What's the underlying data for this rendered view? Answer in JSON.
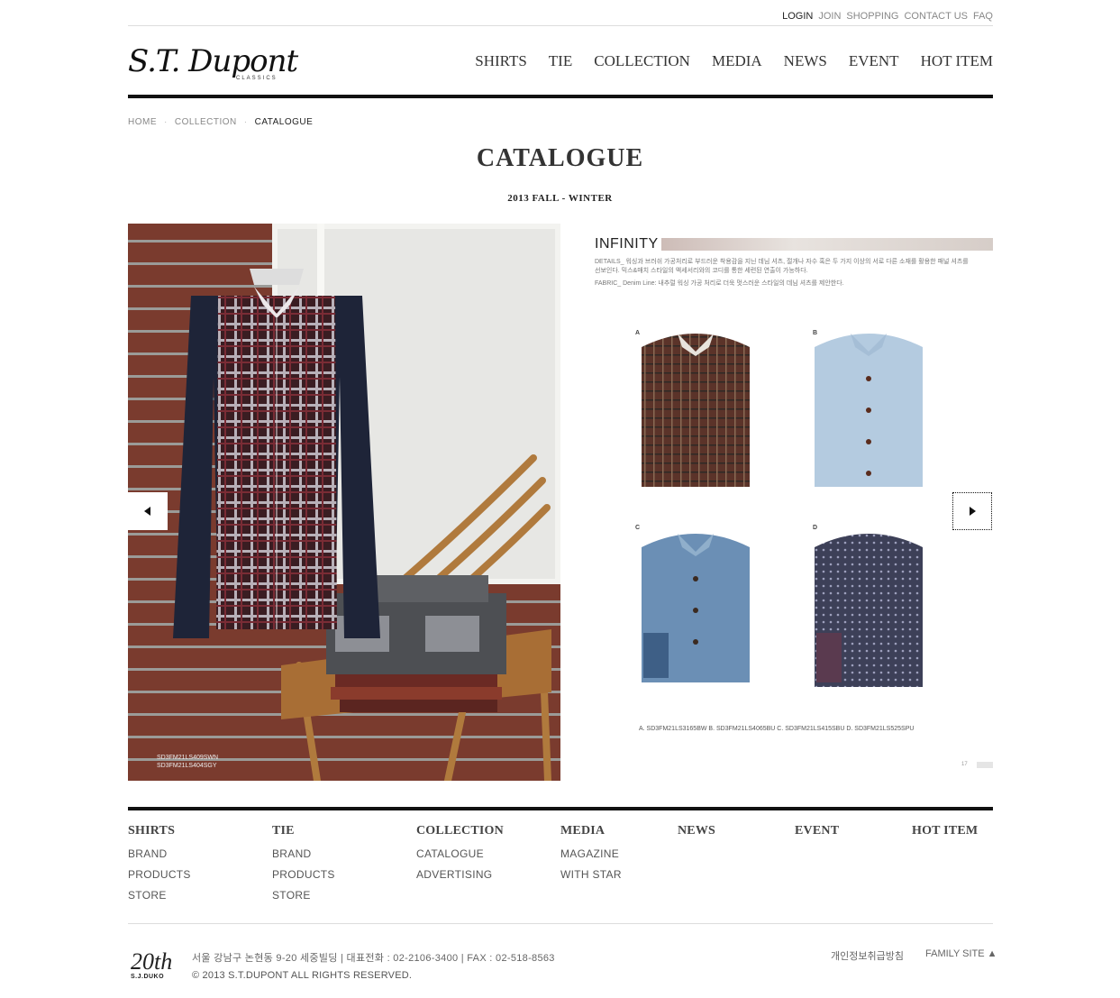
{
  "util_nav": [
    "LOGIN",
    "JOIN",
    "SHOPPING",
    "CONTACT US",
    "FAQ"
  ],
  "logo": {
    "text": "S.T. Dupont",
    "sub": "CLASSICS"
  },
  "main_nav": [
    "SHIRTS",
    "TIE",
    "COLLECTION",
    "MEDIA",
    "NEWS",
    "EVENT",
    "HOT ITEM"
  ],
  "breadcrumb": [
    "HOME",
    "COLLECTION",
    "CATALOGUE"
  ],
  "breadcrumb_sep": "·",
  "page": {
    "title": "CATALOGUE",
    "subtitle": "2013 FALL - WINTER"
  },
  "catalogue": {
    "photo_codes": [
      "SD3FM21LS409SWN",
      "SD3FM21LS404SGY"
    ],
    "heading": "INFINITY",
    "details": "DETAILS_ 워싱과 브러쉬 가공처리로 부드러운 착용감을 지닌 데님 셔츠, 절개나 자수 혹은 두 가지 이상의 서로 다른 소재를 활용한 패널 셔츠를 선보인다. 믹스&매치 스타일의 액세서리와의 코디를 통한 세련된 연출이 가능하다.",
    "fabric": "FABRIC_ Denim Line: 내추럴 워싱 가공 처리로 더욱 멋스러운 스타일의 데님 셔츠를 제안한다.",
    "item_labels": [
      "A",
      "B",
      "C",
      "D"
    ],
    "codes": "A. SD3FM21LS3165BW  B. SD3FM21LS4065BU  C. SD3FM21LS415SBU  D. SD3FM21LS525SPU",
    "page_num": "17"
  },
  "sitemap": [
    {
      "head": "SHIRTS",
      "items": [
        "BRAND",
        "PRODUCTS",
        "STORE"
      ]
    },
    {
      "head": "TIE",
      "items": [
        "BRAND",
        "PRODUCTS",
        "STORE"
      ]
    },
    {
      "head": "COLLECTION",
      "items": [
        "CATALOGUE",
        "ADVERTISING"
      ]
    },
    {
      "head": "MEDIA",
      "items": [
        "MAGAZINE",
        "WITH STAR"
      ]
    },
    {
      "head": "NEWS",
      "items": []
    },
    {
      "head": "EVENT",
      "items": []
    },
    {
      "head": "HOT ITEM",
      "items": []
    }
  ],
  "footer": {
    "anniv_num": "20th",
    "anniv_sub": "S.J.DUKO",
    "address": "서울 강남구 논현동 9-20 세중빌딩  |  대표전화 : 02-2106-3400  |  FAX : 02-518-8563",
    "copyright": "© 2013 S.T.DUPONT ALL RIGHTS RESERVED.",
    "privacy": "개인정보취급방침",
    "family": "FAMILY SITE ▲"
  }
}
